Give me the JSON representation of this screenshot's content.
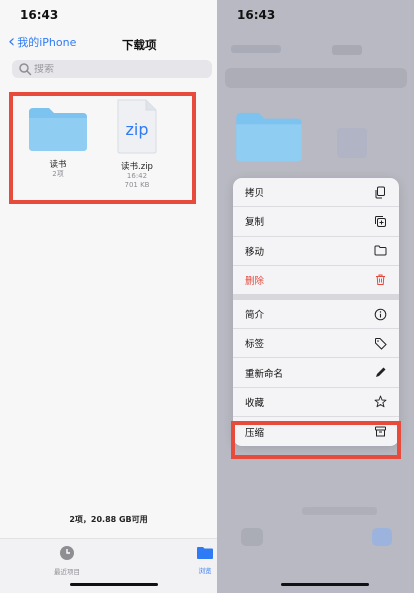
{
  "left": {
    "status_time": "16:43",
    "nav": {
      "back_label": "我的iPhone",
      "title": "下载项"
    },
    "search": {
      "placeholder": "搜索"
    },
    "files": [
      {
        "name": "读书",
        "meta1": "2项",
        "meta2": "",
        "icon": "folder-icon"
      },
      {
        "name": "读书.zip",
        "meta1": "16:42",
        "meta2": "701 KB",
        "icon": "zip-file-icon",
        "badge": "zip"
      }
    ],
    "storage_text": "2项，20.88 GB可用",
    "tabs": [
      {
        "label": "最近项目",
        "icon": "clock-icon"
      },
      {
        "label": "浏览",
        "icon": "folder-icon",
        "active": true
      }
    ]
  },
  "right": {
    "status_time": "16:43",
    "menu": [
      {
        "label": "拷贝",
        "icon": "copy-icon"
      },
      {
        "label": "复制",
        "icon": "duplicate-icon"
      },
      {
        "label": "移动",
        "icon": "folder-icon"
      },
      {
        "label": "删除",
        "icon": "trash-icon",
        "destructive": true
      },
      {
        "label": "简介",
        "icon": "info-icon"
      },
      {
        "label": "标签",
        "icon": "tag-icon"
      },
      {
        "label": "重新命名",
        "icon": "pencil-icon"
      },
      {
        "label": "收藏",
        "icon": "star-icon"
      },
      {
        "label": "压缩",
        "icon": "archive-icon"
      }
    ]
  },
  "colors": {
    "accent": "#2f7bf5",
    "highlight": "#e64b3c",
    "destructive": "#e5483b",
    "folder": "#7cc3f0"
  }
}
